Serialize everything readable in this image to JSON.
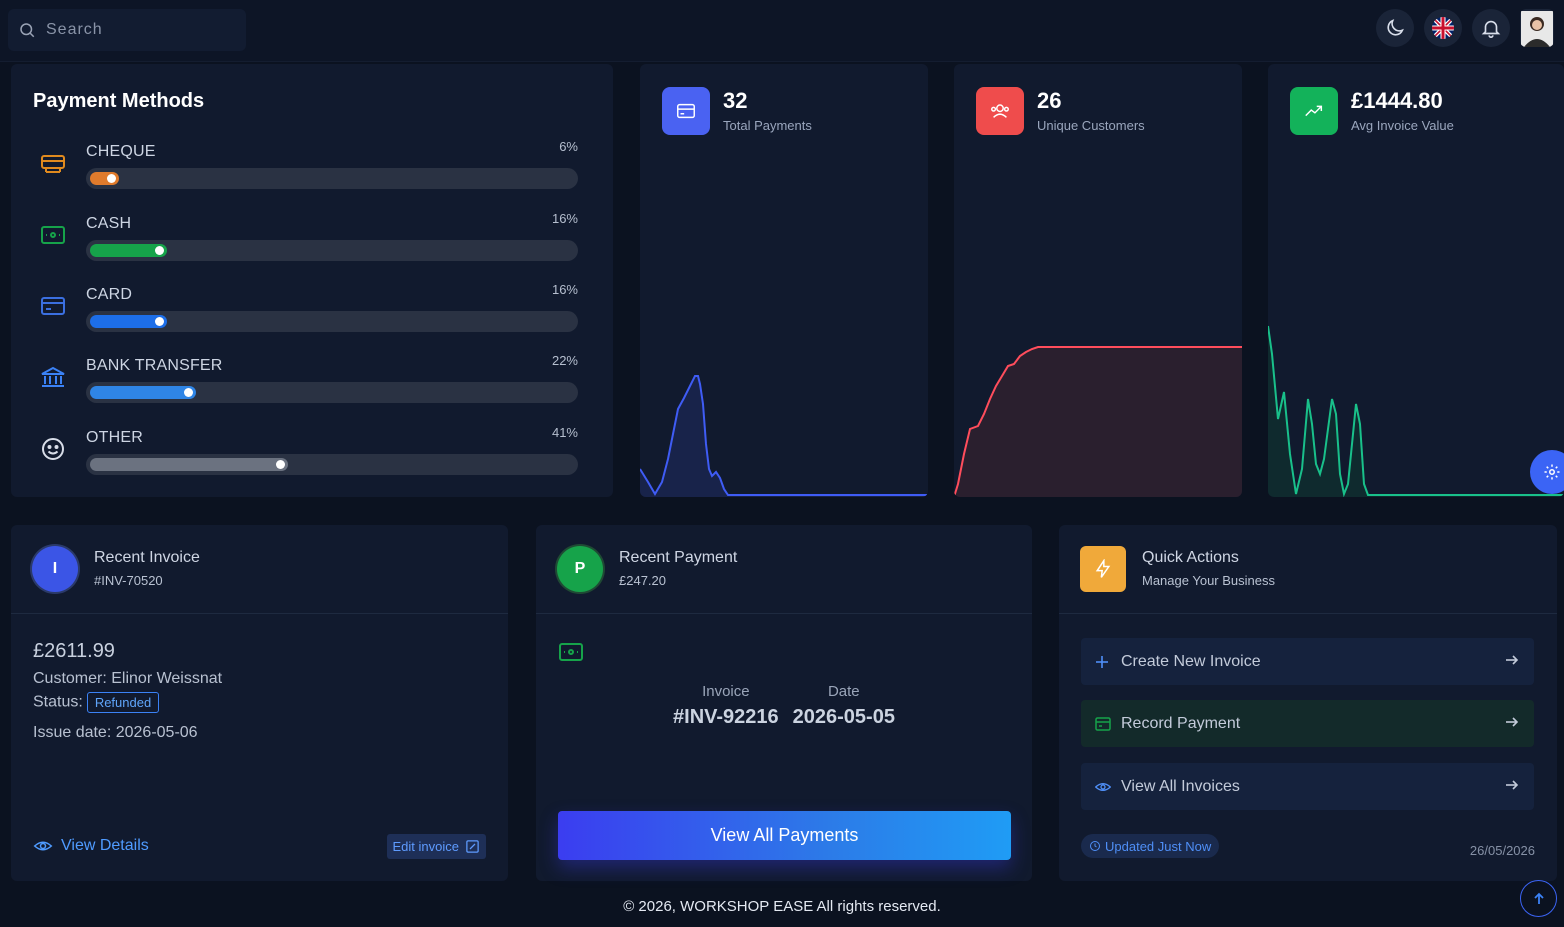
{
  "search": {
    "placeholder": "Search"
  },
  "header_icons": [
    "moon-icon",
    "uk-flag-icon",
    "bell-icon",
    "user-avatar"
  ],
  "payment_methods": {
    "title": "Payment Methods",
    "items": [
      {
        "label": "CHEQUE",
        "percent": "6%",
        "value": 6,
        "color": "#e07b2c",
        "icon": "cheque-icon"
      },
      {
        "label": "CASH",
        "percent": "16%",
        "value": 16,
        "color": "#16a34a",
        "icon": "cash-icon"
      },
      {
        "label": "CARD",
        "percent": "16%",
        "value": 16,
        "color": "#1d6ee8",
        "icon": "card-icon"
      },
      {
        "label": "BANK TRANSFER",
        "percent": "22%",
        "value": 22,
        "color": "#2f85e6",
        "icon": "bank-icon"
      },
      {
        "label": "OTHER",
        "percent": "41%",
        "value": 41,
        "color": "#6b7280",
        "icon": "smile-icon"
      }
    ]
  },
  "stats": [
    {
      "value": "32",
      "label": "Total Payments",
      "color": "#4a62f2",
      "line": "#3f5cf5",
      "icon": "card-icon"
    },
    {
      "value": "26",
      "label": "Unique Customers",
      "color": "#ef4c4c",
      "line": "#ff4d5c",
      "icon": "users-icon"
    },
    {
      "value": "£1444.80",
      "label": "Avg Invoice Value",
      "color": "#13b25a",
      "line": "#19c08a",
      "icon": "trend-up-icon"
    }
  ],
  "recent_invoice": {
    "avatar": "I",
    "title": "Recent Invoice",
    "number": "#INV-70520",
    "amount": "£2611.99",
    "customer": "Customer: Elinor Weissnat",
    "status_label": "Status:",
    "status": "Refunded",
    "issue_date": "Issue date: 2026-05-06",
    "view_details": "View Details",
    "edit": "Edit invoice"
  },
  "recent_payment": {
    "avatar": "P",
    "title": "Recent Payment",
    "amount": "£247.20",
    "invoice_label": "Invoice",
    "invoice_value": "#INV-92216",
    "date_label": "Date",
    "date_value": "2026-05-05",
    "view_all": "View All Payments"
  },
  "quick_actions": {
    "title": "Quick Actions",
    "subtitle": "Manage Your Business",
    "actions": [
      {
        "label": "Create New Invoice",
        "icon": "plus-icon",
        "bg": "#15223d"
      },
      {
        "label": "Record Payment",
        "icon": "payment-icon",
        "bg": "#132a2a"
      },
      {
        "label": "View All Invoices",
        "icon": "eye-icon",
        "bg": "#15223d"
      }
    ],
    "updated": "Updated Just Now",
    "date": "26/05/2026"
  },
  "footer": "© 2026, WORKSHOP EASE All rights reserved."
}
